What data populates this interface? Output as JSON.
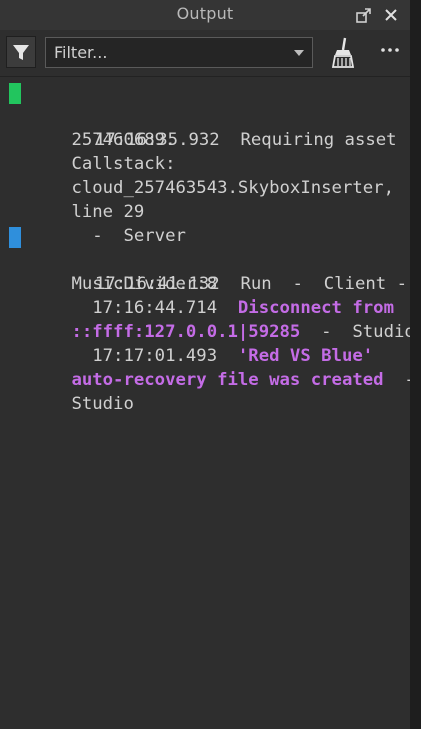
{
  "window": {
    "title": "Output"
  },
  "toolbar": {
    "filter_placeholder": "Filter..."
  },
  "icons": {
    "undock": "undock-icon",
    "close": "close-icon",
    "filter": "filter-icon",
    "dropdown": "chevron-down-icon",
    "clear": "broom-icon",
    "more": "more-icon"
  },
  "colors": {
    "panel_bg": "#2e2e2e",
    "text": "#d0d0d0",
    "emphasis": "#c46ce6",
    "marker_server": "#22c55e",
    "marker_client": "#2f8fdc"
  },
  "log": {
    "e1": {
      "l1_pre": " 17:16:35.932  Requiring asset",
      "l2": "257460689.",
      "l3": "Callstack:",
      "l4": "cloud_257463543.SkyboxInserter,",
      "l5": "line 29",
      "l6": "  -  Server"
    },
    "e2": {
      "l1_pre": " 17:16:41.132  Run  -  Client -",
      "l2": "MusicDivider:8"
    },
    "e3": {
      "l1_pre": "  17:16:44.714  ",
      "l1_em": "Disconnect from",
      "l2_em": "::ffff:127.0.0.1|59285",
      "l2_post": "  -  Studio"
    },
    "e4": {
      "l1_pre": "  17:17:01.493  ",
      "l1_em": "'Red VS Blue'",
      "l2_em": "auto-recovery file was created",
      "l2_post": "  -",
      "l3": "Studio"
    }
  }
}
